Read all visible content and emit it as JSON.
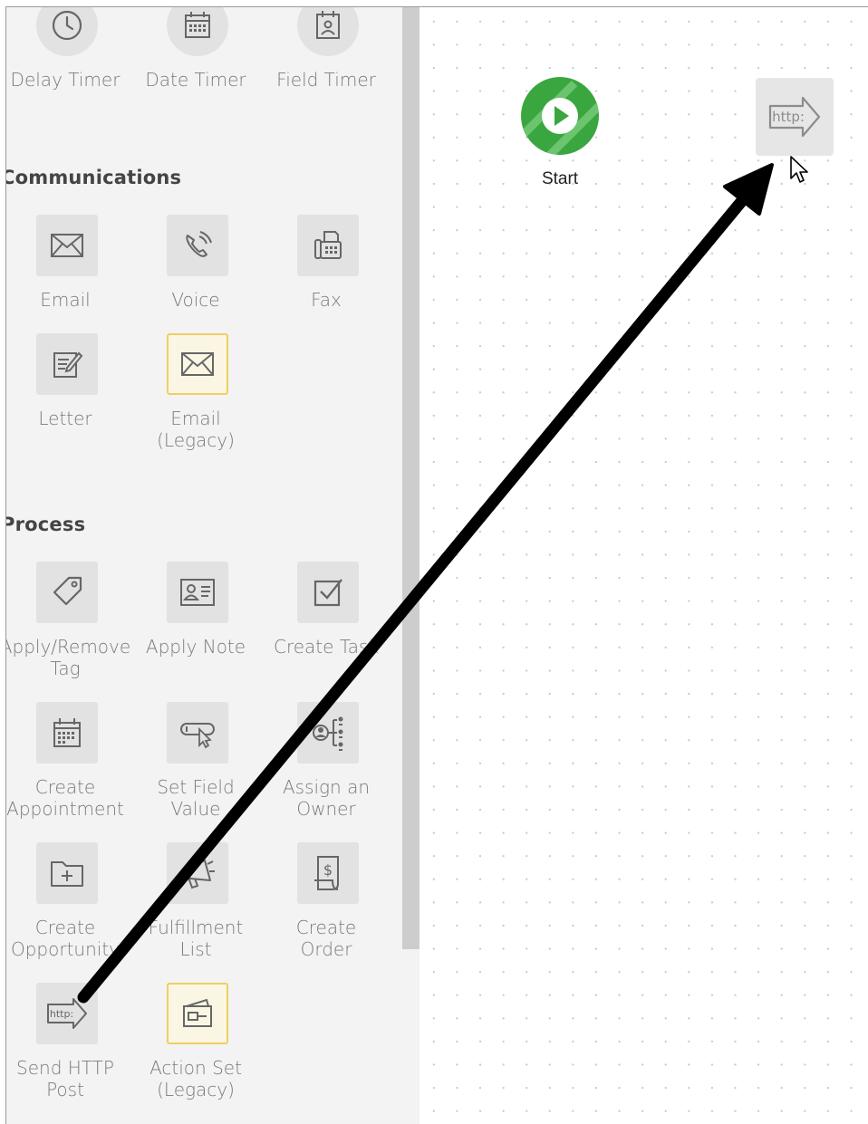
{
  "timers": {
    "items": [
      {
        "label": "Delay Timer",
        "icon": "clock-icon"
      },
      {
        "label": "Date Timer",
        "icon": "calendar-icon"
      },
      {
        "label": "Field Timer",
        "icon": "contact-card-calendar-icon"
      }
    ]
  },
  "communications": {
    "title": "Communications",
    "items": [
      {
        "label": "Email",
        "icon": "envelope-icon"
      },
      {
        "label": "Voice",
        "icon": "phone-icon"
      },
      {
        "label": "Fax",
        "icon": "fax-icon"
      },
      {
        "label": "Letter",
        "icon": "letter-edit-icon"
      },
      {
        "label": "Email\n(Legacy)",
        "icon": "envelope-icon",
        "legacy": true
      }
    ]
  },
  "process": {
    "title": "Process",
    "items": [
      {
        "label": "Apply/Remove\nTag",
        "icon": "tag-icon"
      },
      {
        "label": "Apply Note",
        "icon": "note-card-icon"
      },
      {
        "label": "Create Task",
        "icon": "checkbox-icon"
      },
      {
        "label": "Create\nAppointment",
        "icon": "calendar-icon"
      },
      {
        "label": "Set Field\nValue",
        "icon": "field-cursor-icon"
      },
      {
        "label": "Assign an\nOwner",
        "icon": "owner-tree-icon"
      },
      {
        "label": "Create\nOpportunity",
        "icon": "folder-plus-icon"
      },
      {
        "label": "Fulfillment\nList",
        "icon": "megaphone-icon"
      },
      {
        "label": "Create\nOrder",
        "icon": "receipt-dollar-icon"
      },
      {
        "label": "Send HTTP\nPost",
        "icon": "http-arrow-icon"
      },
      {
        "label": "Action Set\n(Legacy)",
        "icon": "wallet-icon",
        "legacy": true
      }
    ]
  },
  "canvas": {
    "start_label": "Start",
    "http_node_text": "http:"
  },
  "colors": {
    "start_green": "#3aa63f",
    "legacy_border": "#f0cf63",
    "sidebar_bg": "#f3f3f3"
  }
}
